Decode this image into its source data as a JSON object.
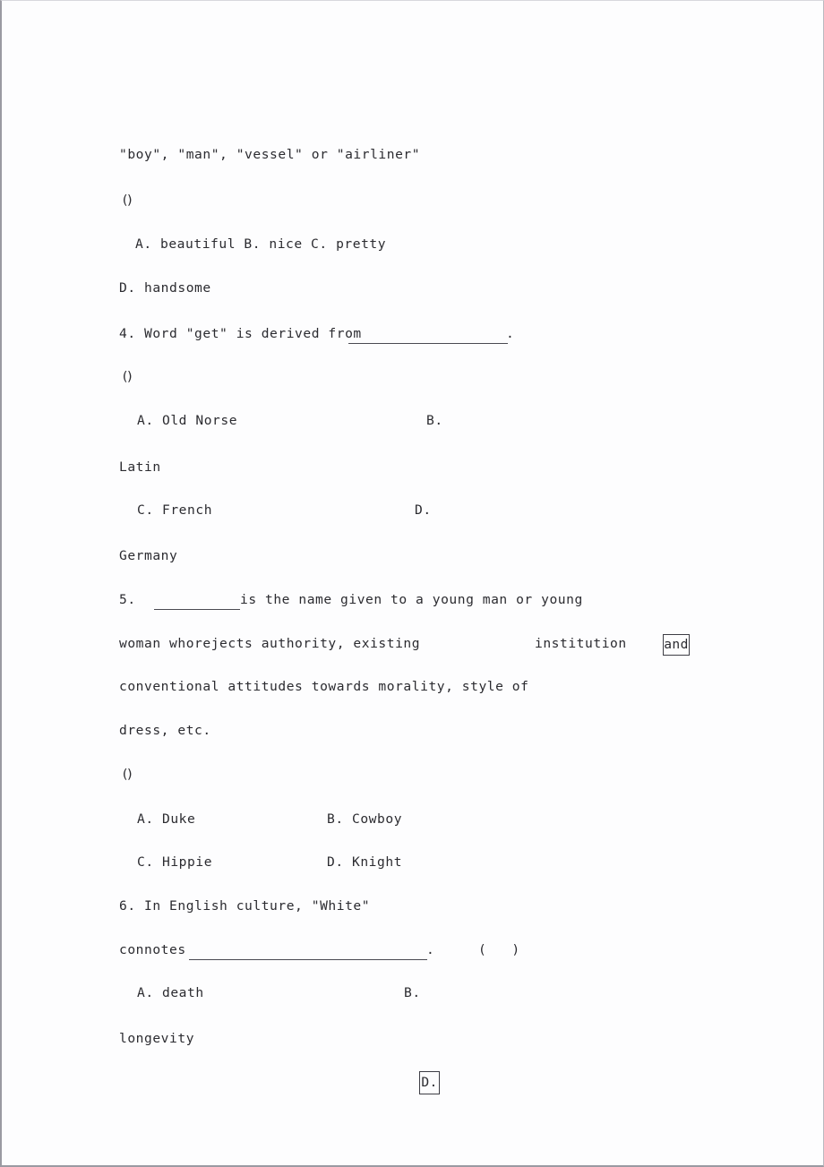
{
  "document": {
    "type": "exam-worksheet",
    "page_background": "#fdfdfe",
    "text_color": "#2b2b30",
    "border_color": "#9a9aa2"
  },
  "lines": {
    "l1": "\"boy\", \"man\", \"vessel\" or \"airliner\"",
    "l2": "()",
    "l3": "A. beautiful B. nice C. pretty",
    "l4": "D. handsome",
    "l5_prefix": "4. Word \"get\" is derived from ",
    "l5_suffix": ".",
    "l6": "()",
    "l7_a": "A. Old Norse",
    "l7_b": "B.",
    "l8": "Latin",
    "l9_c": "C. French",
    "l9_d": "D.",
    "l10": "Germany",
    "l11_num": "5.",
    "l11_rest": "is the name given to a young man or young",
    "l12_a": "woman whorejects authority, existing",
    "l12_b": "institution",
    "l12_boxed": "and",
    "l13": "conventional attitudes towards morality, style of",
    "l14": "dress, etc.",
    "l15": "()",
    "l16_a": "A. Duke",
    "l16_b": "B. Cowboy",
    "l17_c": "C. Hippie",
    "l17_d": "D. Knight",
    "l18": "6. In English culture, \"White\"",
    "l19_prefix": "connotes ",
    "l19_suffix": ".",
    "l19_paren": "(   )",
    "l20_a": "A. death",
    "l20_b": "B.",
    "l21": "longevity",
    "l22_boxed": "D."
  }
}
